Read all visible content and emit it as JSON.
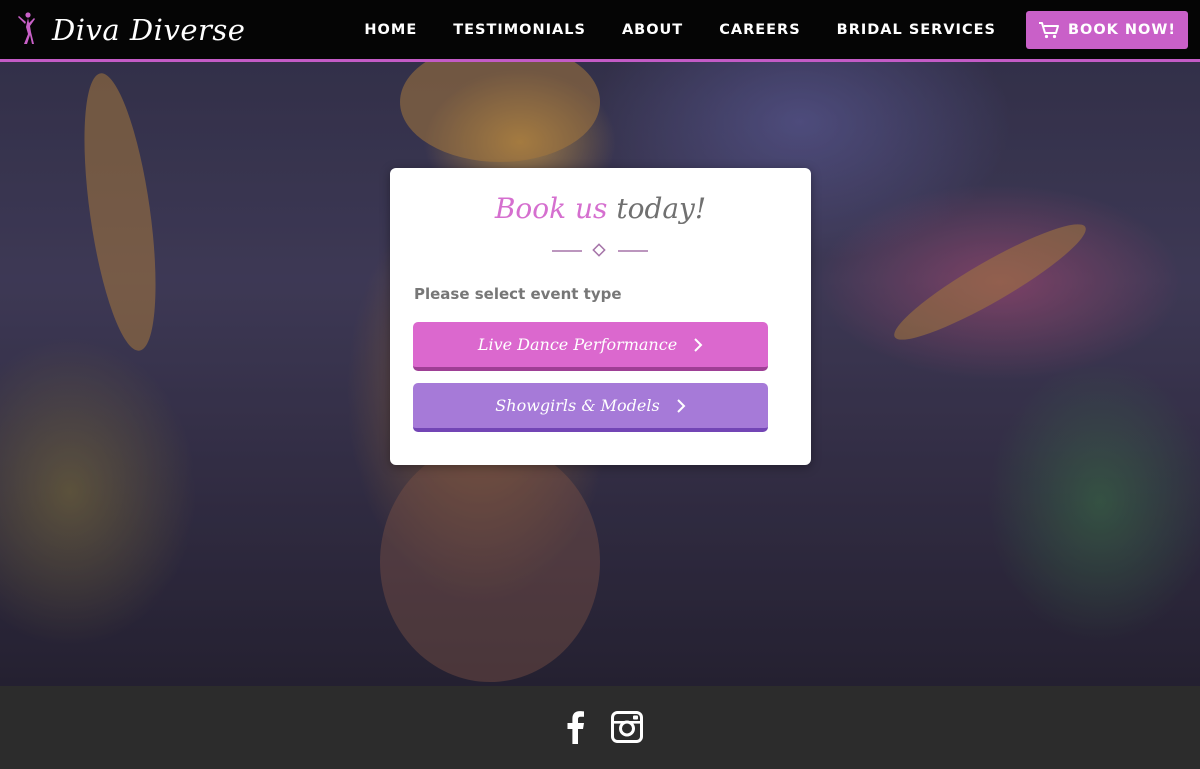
{
  "brand": {
    "name": "Diva Diverse",
    "logo_icon": "dancer-silhouette-icon",
    "accent_color": "#c960c8"
  },
  "nav": {
    "items": [
      {
        "label": "HOME"
      },
      {
        "label": "TESTIMONIALS"
      },
      {
        "label": "ABOUT"
      },
      {
        "label": "CAREERS"
      },
      {
        "label": "BRIDAL SERVICES"
      }
    ],
    "cta": {
      "label": "BOOK NOW!",
      "icon": "cart-icon"
    }
  },
  "hero": {
    "background": "carnival-dancer-photo"
  },
  "booking": {
    "title_part1": "Book us",
    "title_part2": "today!",
    "prompt": "Please select event type",
    "options": [
      {
        "label": "Live Dance Performance",
        "color": "#db68ce",
        "icon": "chevron-right-icon"
      },
      {
        "label": "Showgirls & Models",
        "color": "#a67ad8",
        "icon": "chevron-right-icon"
      }
    ]
  },
  "footer": {
    "social": [
      {
        "icon": "facebook-icon"
      },
      {
        "icon": "instagram-icon"
      }
    ]
  }
}
